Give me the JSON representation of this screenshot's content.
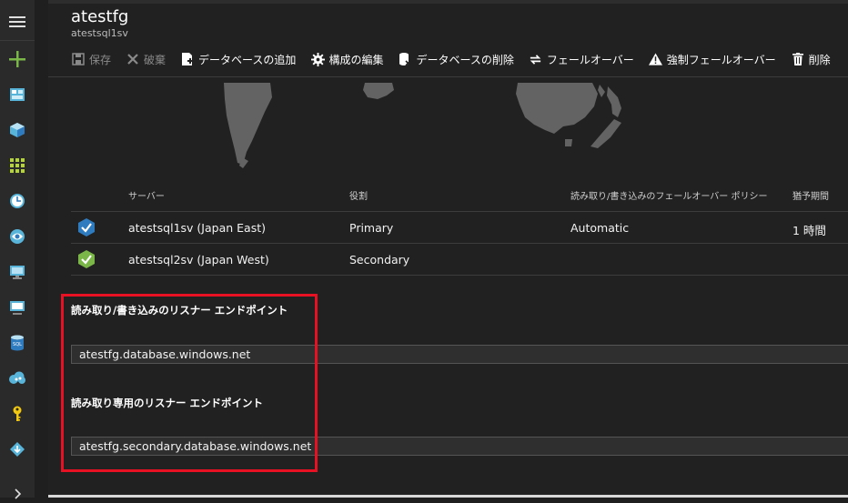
{
  "header": {
    "title": "atestfg",
    "subtitle": "atestsql1sv"
  },
  "toolbar": {
    "save": "保存",
    "discard": "破棄",
    "add_db": "データベースの追加",
    "edit_config": "構成の編集",
    "remove_db": "データベースの削除",
    "failover": "フェールオーバー",
    "forced_failover": "強制フェールオーバー",
    "delete": "削除"
  },
  "table": {
    "headers": {
      "server": "サーバー",
      "role": "役割",
      "policy": "読み取り/書き込みのフェールオーバー ポリシー",
      "grace": "猶予期間"
    },
    "rows": [
      {
        "server": "atestsql1sv (Japan East)",
        "role": "Primary",
        "policy": "Automatic",
        "grace": "1 時間",
        "status_color": "#2f7bbf"
      },
      {
        "server": "atestsql2sv (Japan West)",
        "role": "Secondary",
        "policy": "",
        "grace": "",
        "status_color": "#7ab648"
      }
    ]
  },
  "endpoints": {
    "rw_label": "読み取り/書き込みのリスナー エンドポイント",
    "rw_value": "atestfg.database.windows.net",
    "ro_label": "読み取り専用のリスナー エンドポイント",
    "ro_value": "atestfg.secondary.database.windows.net"
  },
  "sidebar_icons": [
    "menu-icon",
    "new-icon",
    "dashboard-icon",
    "resource-groups-icon",
    "all-resources-icon",
    "recent-icon",
    "app-services-icon",
    "virtual-machines-icon",
    "cloud-services-icon",
    "sql-databases-icon",
    "storage-icon",
    "key-icon",
    "marketplace-icon",
    "expand-icon"
  ],
  "colors": {
    "highlight": "#e81123",
    "add": "#7ab648",
    "accent": "#2f7bbf"
  }
}
